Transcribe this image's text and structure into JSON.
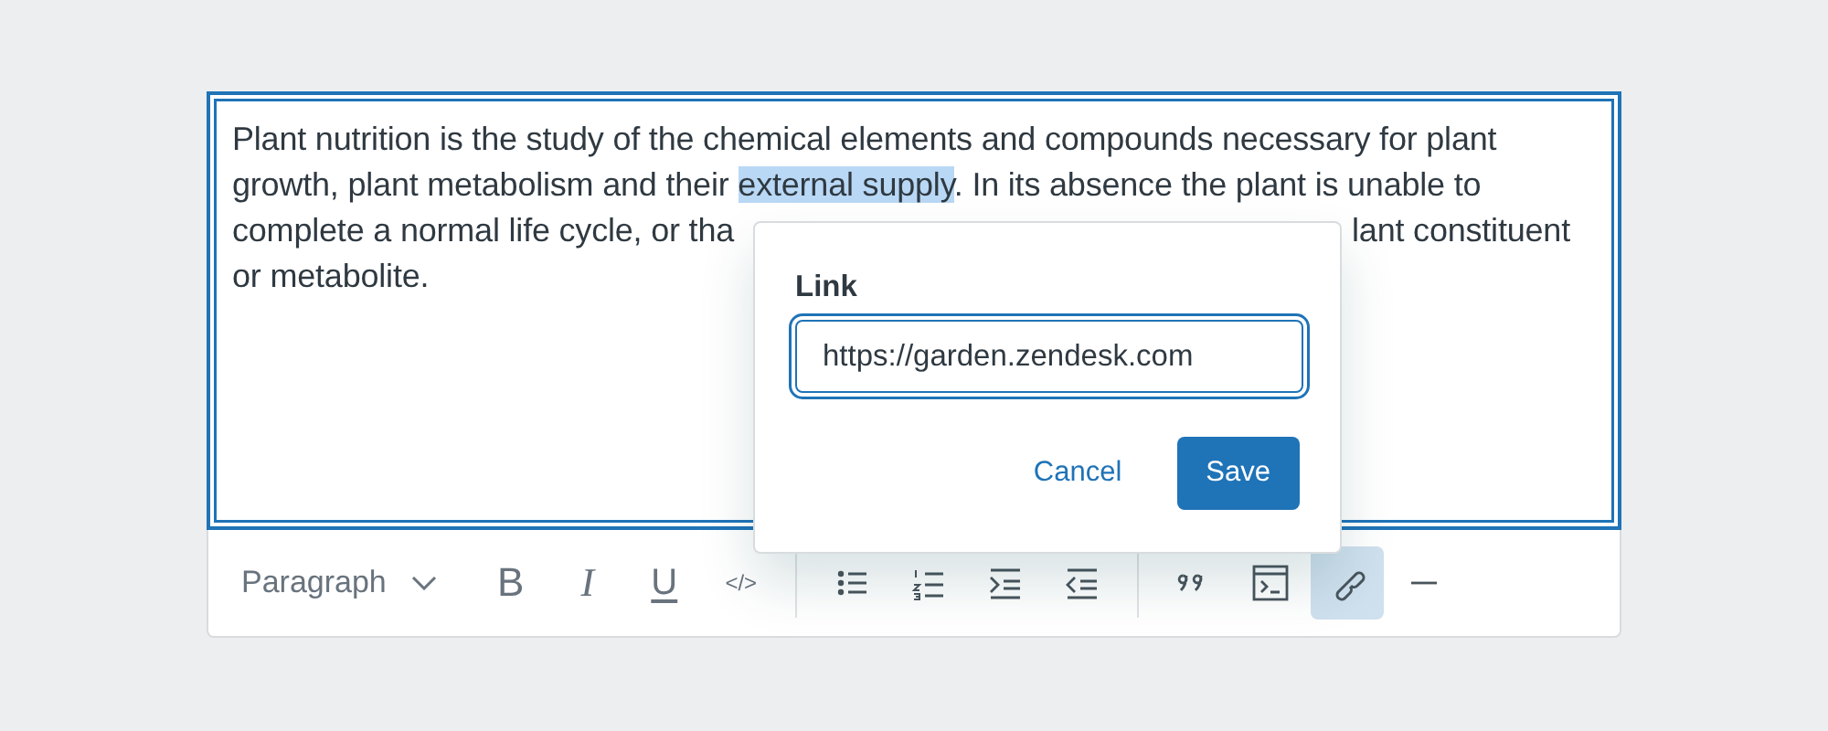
{
  "editor": {
    "focused": true,
    "lines": [
      [
        {
          "text": "Plant nutrition is the study of the chemical elements and compounds necessary for plant",
          "selected": false
        }
      ],
      [
        {
          "text": "growth, plant metabolism and their ",
          "selected": false
        },
        {
          "text": "external supply",
          "selected": true
        },
        {
          "text": ". In its absence the plant is unable to",
          "selected": false
        }
      ],
      [
        {
          "text": "complete a normal life cycle, or tha",
          "selected": false
        },
        {
          "text": "lant constituent",
          "selected": false
        }
      ],
      [
        {
          "text": "or metabolite.",
          "selected": false
        }
      ]
    ]
  },
  "toolbar": {
    "block_type": "Paragraph",
    "groups": [
      [
        {
          "kind": "bold",
          "label": "B",
          "selected": false
        },
        {
          "kind": "italic",
          "label": "I",
          "selected": false
        },
        {
          "kind": "underline",
          "label": "U",
          "selected": false
        },
        {
          "kind": "code",
          "label": "</>",
          "selected": false
        }
      ],
      [
        {
          "kind": "bullet-list",
          "selected": false
        },
        {
          "kind": "numbered-list",
          "selected": false
        },
        {
          "kind": "indent",
          "selected": false
        },
        {
          "kind": "outdent",
          "selected": false
        }
      ],
      [
        {
          "kind": "quote",
          "selected": false
        },
        {
          "kind": "code-block",
          "selected": false
        },
        {
          "kind": "link",
          "selected": true
        },
        {
          "kind": "rule",
          "selected": false
        }
      ]
    ]
  },
  "link_popover": {
    "label": "Link",
    "value": "https://garden.zendesk.com",
    "buttons": [
      {
        "kind": "secondary",
        "label": "Cancel"
      },
      {
        "kind": "primary",
        "label": "Save"
      }
    ]
  }
}
